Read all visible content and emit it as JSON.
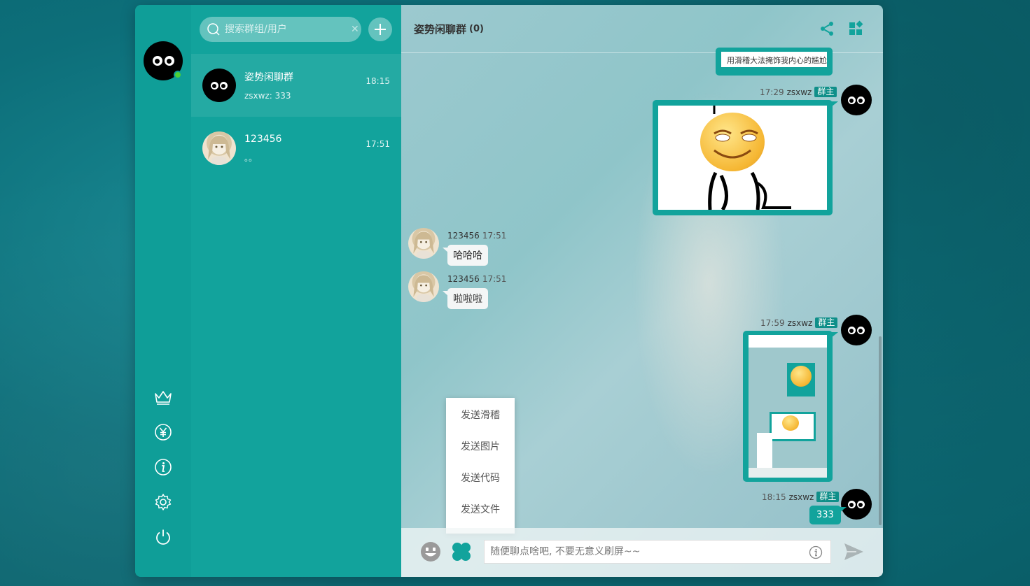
{
  "search": {
    "placeholder": "搜索群组/用户",
    "clear": "✕"
  },
  "conversations": [
    {
      "name": "姿势闲聊群",
      "last": "zsxwz: 333",
      "time": "18:15"
    },
    {
      "name": "123456",
      "last": "。。",
      "time": "17:51"
    }
  ],
  "chat": {
    "title": "姿势闲聊群",
    "count": "(0)",
    "cut_message": "用滑稽大法掩饰我内心的尴尬",
    "messages": [
      {
        "time": "17:29",
        "user": "zsxwz",
        "badge": "群主"
      },
      {
        "user": "123456",
        "time": "17:51",
        "text": "哈哈哈"
      },
      {
        "user": "123456",
        "time": "17:51",
        "text": "啦啦啦"
      },
      {
        "time": "17:59",
        "user": "zsxwz",
        "badge": "群主"
      },
      {
        "time": "18:15",
        "user": "zsxwz",
        "badge": "群主",
        "text": "333"
      }
    ]
  },
  "menu": {
    "items": [
      "发送滑稽",
      "发送图片",
      "发送代码",
      "发送文件"
    ]
  },
  "input": {
    "placeholder": "随便聊点啥吧, 不要无意义刷屏~~"
  },
  "colors": {
    "primary": "#12a39c",
    "rail": "#0f9e98",
    "online": "#4cd137"
  }
}
